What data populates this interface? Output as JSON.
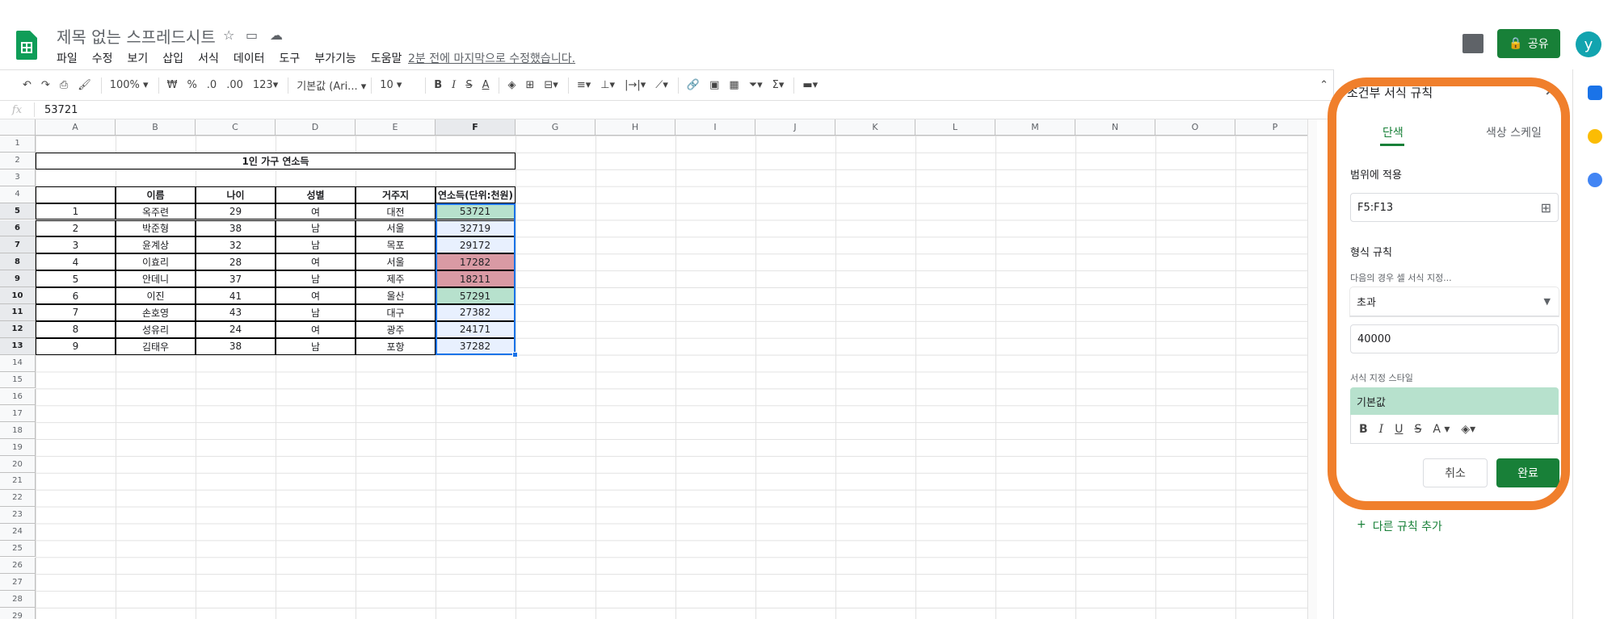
{
  "header": {
    "title": "제목 없는 스프레드시트",
    "menu": [
      "파일",
      "수정",
      "보기",
      "삽입",
      "서식",
      "데이터",
      "도구",
      "부가기능",
      "도움말"
    ],
    "last_edit": "2분 전에 마지막으로 수정했습니다.",
    "share_label": "공유",
    "avatar_initial": "y"
  },
  "toolbar": {
    "zoom": "100%",
    "currency": "₩",
    "percent": "%",
    "dec_decrease": ".0",
    "dec_increase": ".00",
    "number_format": "123",
    "font": "기본값 (Ari...",
    "font_size": "10",
    "bold": "B",
    "italic": "I",
    "strike": "S",
    "text_color": "A",
    "sigma": "Σ"
  },
  "formula_bar": {
    "fx": "fx",
    "value": "53721"
  },
  "columns": [
    "A",
    "B",
    "C",
    "D",
    "E",
    "F",
    "G",
    "H",
    "I",
    "J",
    "K",
    "L",
    "M",
    "N",
    "O",
    "P"
  ],
  "rows": [
    "1",
    "2",
    "3",
    "4",
    "5",
    "6",
    "7",
    "8",
    "9",
    "10",
    "11",
    "12",
    "13",
    "14",
    "15",
    "16",
    "17",
    "18",
    "19",
    "20",
    "21",
    "22",
    "23",
    "24",
    "25",
    "26",
    "27",
    "28",
    "29"
  ],
  "table": {
    "title": "1인 가구 연소득",
    "headers": [
      "",
      "이름",
      "나이",
      "성별",
      "거주지",
      "연소득(단위:천원)"
    ],
    "rows": [
      {
        "no": "1",
        "name": "옥주련",
        "age": "29",
        "gender": "여",
        "city": "대전",
        "income": "53721",
        "fill": "green"
      },
      {
        "no": "2",
        "name": "박준형",
        "age": "38",
        "gender": "남",
        "city": "서울",
        "income": "32719",
        "fill": "none"
      },
      {
        "no": "3",
        "name": "윤계상",
        "age": "32",
        "gender": "남",
        "city": "목포",
        "income": "29172",
        "fill": "none"
      },
      {
        "no": "4",
        "name": "이효리",
        "age": "28",
        "gender": "여",
        "city": "서울",
        "income": "17282",
        "fill": "red"
      },
      {
        "no": "5",
        "name": "안데니",
        "age": "37",
        "gender": "남",
        "city": "제주",
        "income": "18211",
        "fill": "red"
      },
      {
        "no": "6",
        "name": "이진",
        "age": "41",
        "gender": "여",
        "city": "울산",
        "income": "57291",
        "fill": "green"
      },
      {
        "no": "7",
        "name": "손호영",
        "age": "43",
        "gender": "남",
        "city": "대구",
        "income": "27382",
        "fill": "none"
      },
      {
        "no": "8",
        "name": "성유리",
        "age": "24",
        "gender": "여",
        "city": "광주",
        "income": "24171",
        "fill": "none"
      },
      {
        "no": "9",
        "name": "김태우",
        "age": "38",
        "gender": "남",
        "city": "포항",
        "income": "37282",
        "fill": "none"
      }
    ]
  },
  "panel": {
    "title": "조건부 서식 규칙",
    "tab_single": "단색",
    "tab_scale": "색상 스케일",
    "range_label": "범위에 적용",
    "range_value": "F5:F13",
    "rule_label": "형식 규칙",
    "condition_label": "다음의 경우 셀 서식 지정...",
    "condition_value": "초과",
    "value_input": "40000",
    "style_label": "서식 지정 스타일",
    "style_preview": "기본값",
    "cancel": "취소",
    "done": "완료",
    "add_rule": "다른 규칙 추가"
  },
  "colors": {
    "green_fill": "#b7e1cd",
    "red_fill": "#d99aa4",
    "selection_fill": "#e8f0fe",
    "accent": "#188038",
    "highlight_ring": "#f07f2c"
  }
}
